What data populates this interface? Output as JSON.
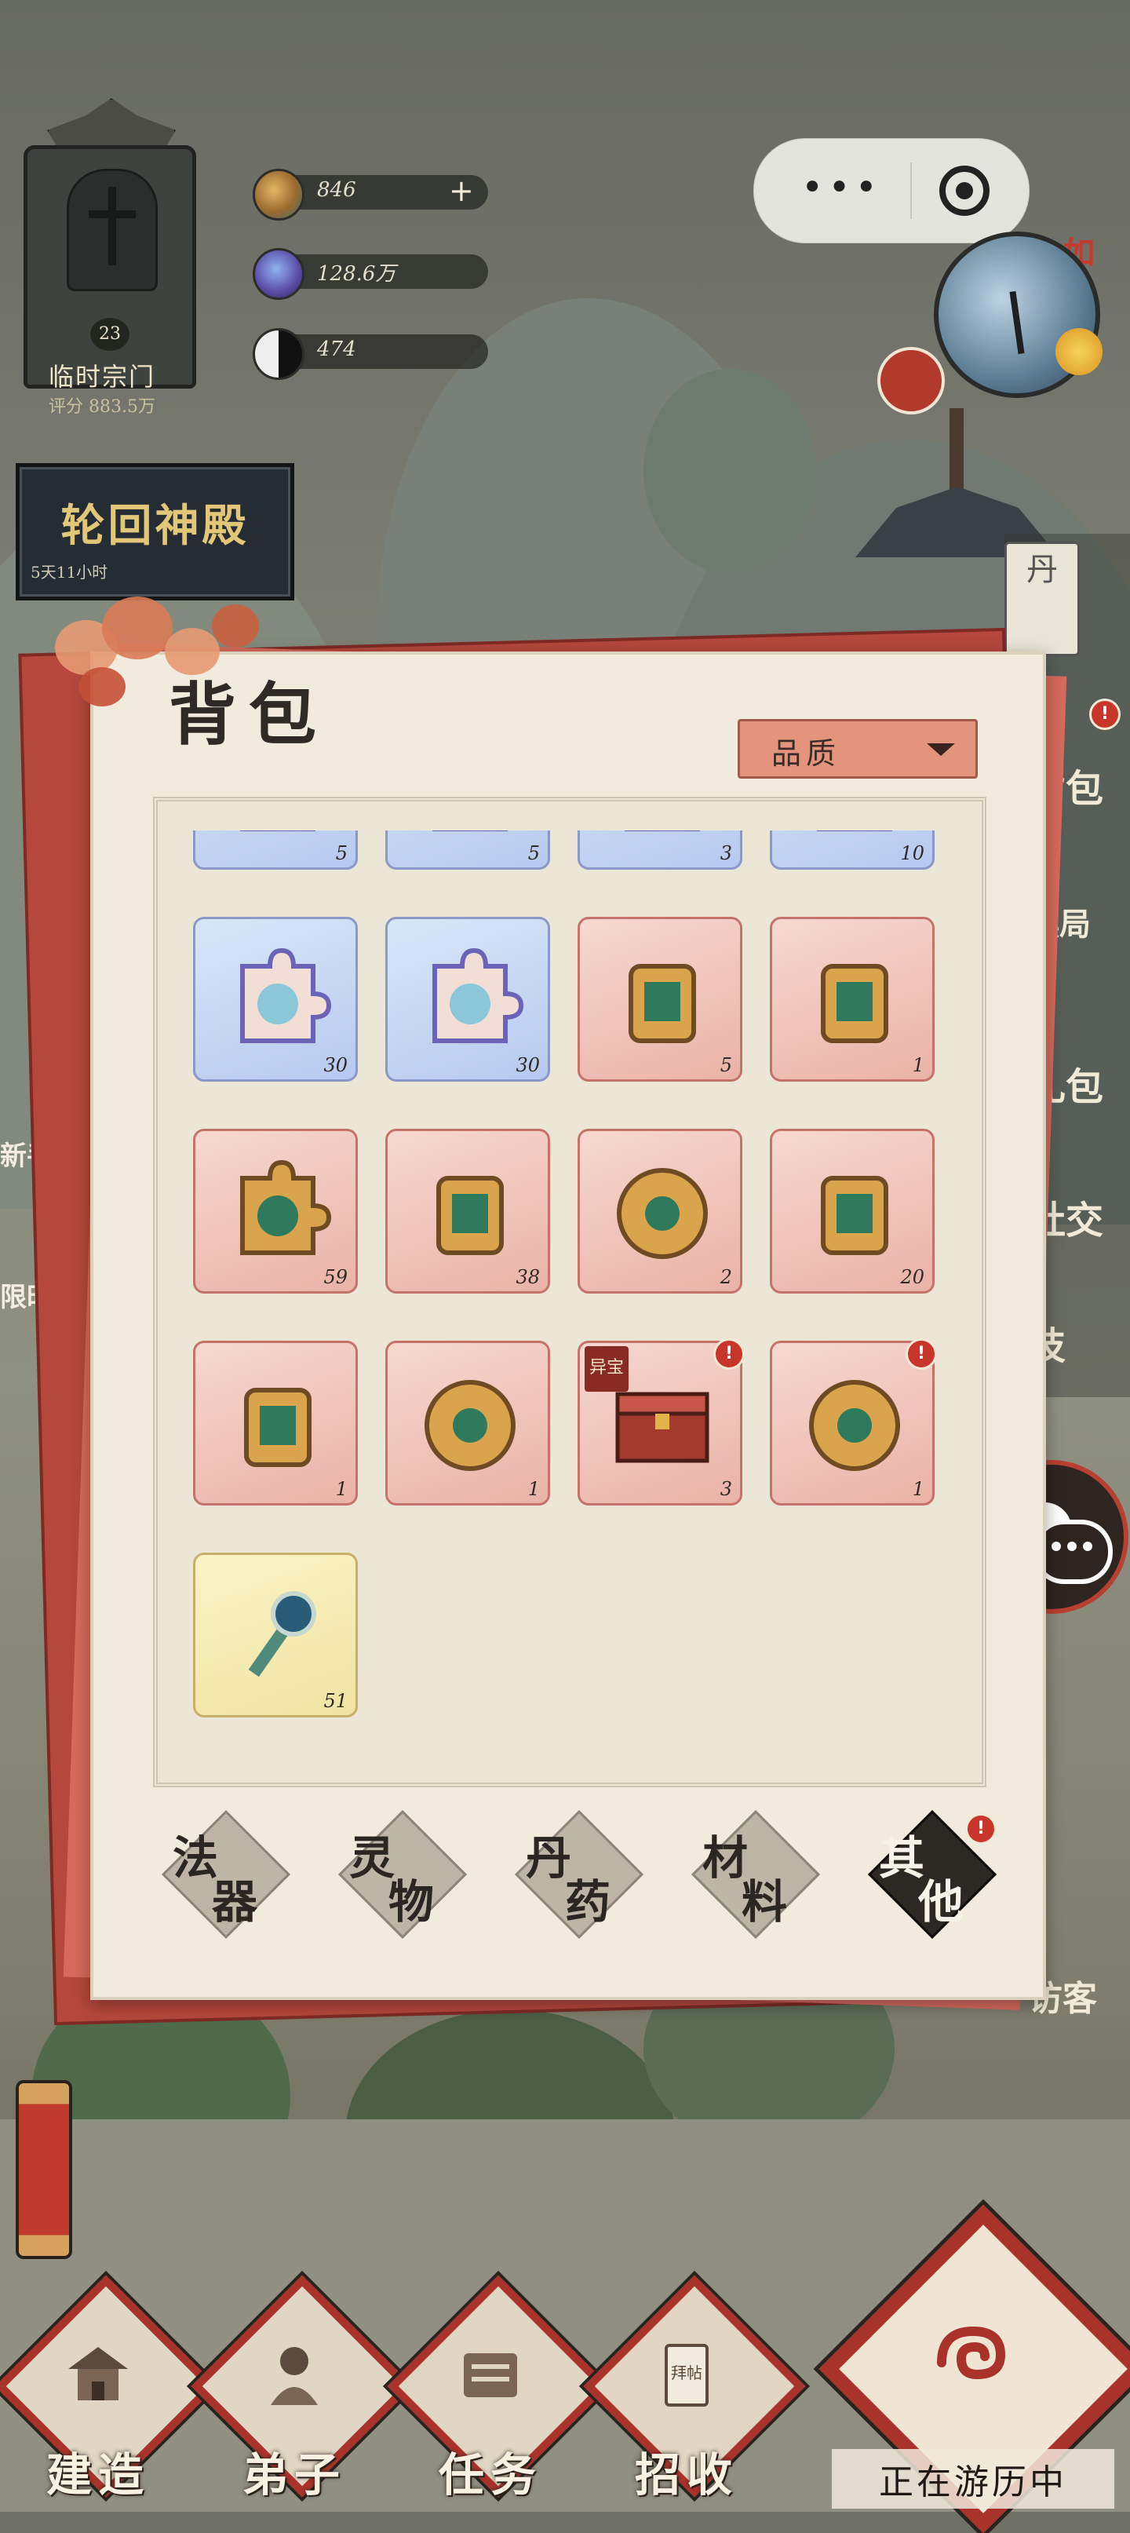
{
  "resources": [
    {
      "name": "spirit-stone",
      "value": "846",
      "has_plus": true
    },
    {
      "name": "crystal",
      "value": "128.6万",
      "has_plus": false
    },
    {
      "name": "yin-yang",
      "value": "474",
      "has_plus": false
    }
  ],
  "sect": {
    "level": "23",
    "name": "临时宗门",
    "score": "评分 883.5万"
  },
  "samsara": {
    "title": "轮回神殿",
    "time": "5天11小时"
  },
  "calendar": {
    "month_text": "如月"
  },
  "right_menu": {
    "alchemy": "丹",
    "items": [
      "背包",
      "棋局",
      "礼包",
      "社交",
      "技"
    ],
    "guest": "访客"
  },
  "left_menu": {
    "newbie": "新手",
    "limited": "限时"
  },
  "backpack": {
    "title": "背包",
    "sort_label": "品质",
    "items": [
      {
        "name": "puzzle-piece-1",
        "rarity": "blue",
        "count": "5"
      },
      {
        "name": "puzzle-piece-2",
        "rarity": "blue",
        "count": "5"
      },
      {
        "name": "puzzle-piece-3",
        "rarity": "blue",
        "count": "3"
      },
      {
        "name": "puzzle-piece-4",
        "rarity": "blue",
        "count": "10"
      },
      {
        "name": "portrait-puzzle-a",
        "rarity": "blue",
        "count": "30"
      },
      {
        "name": "portrait-puzzle-b",
        "rarity": "blue",
        "count": "30"
      },
      {
        "name": "attack-talisman-a",
        "rarity": "red",
        "count": "5"
      },
      {
        "name": "attack-talisman-b",
        "rarity": "red",
        "count": "1"
      },
      {
        "name": "dark-puzzle-piece",
        "rarity": "red",
        "count": "59"
      },
      {
        "name": "red-tassel-token",
        "rarity": "red",
        "count": "38"
      },
      {
        "name": "dragon-coin",
        "rarity": "red",
        "count": "2"
      },
      {
        "name": "jade-pendant",
        "rarity": "red",
        "count": "20"
      },
      {
        "name": "fire-stone",
        "rarity": "red",
        "count": "1"
      },
      {
        "name": "jade-knot-orb",
        "rarity": "red",
        "count": "1"
      },
      {
        "name": "treasure-chest",
        "rarity": "red",
        "count": "3",
        "tag": "异宝",
        "alert": true
      },
      {
        "name": "bronze-mirror",
        "rarity": "red",
        "count": "1",
        "alert": true
      },
      {
        "name": "jade-key",
        "rarity": "gold",
        "count": "51"
      }
    ],
    "tabs": [
      {
        "a": "法",
        "b": "器",
        "active": false,
        "alert": false
      },
      {
        "a": "灵",
        "b": "物",
        "active": false,
        "alert": false
      },
      {
        "a": "丹",
        "b": "药",
        "active": false,
        "alert": false
      },
      {
        "a": "材",
        "b": "料",
        "active": false,
        "alert": false
      },
      {
        "a": "其",
        "b": "他",
        "active": true,
        "alert": true
      }
    ]
  },
  "bottom_nav": [
    {
      "label": "建造"
    },
    {
      "label": "弟子"
    },
    {
      "label": "任务"
    },
    {
      "label": "招收",
      "glyph": "拜帖"
    }
  ],
  "travel": {
    "label": "正在游历中"
  },
  "colors": {
    "accent_red": "#a9332a",
    "panel": "#f0ebdc",
    "blue_slot": "#b7c9ef",
    "red_slot": "#eab3a7",
    "gold_slot": "#f0e4a2"
  }
}
